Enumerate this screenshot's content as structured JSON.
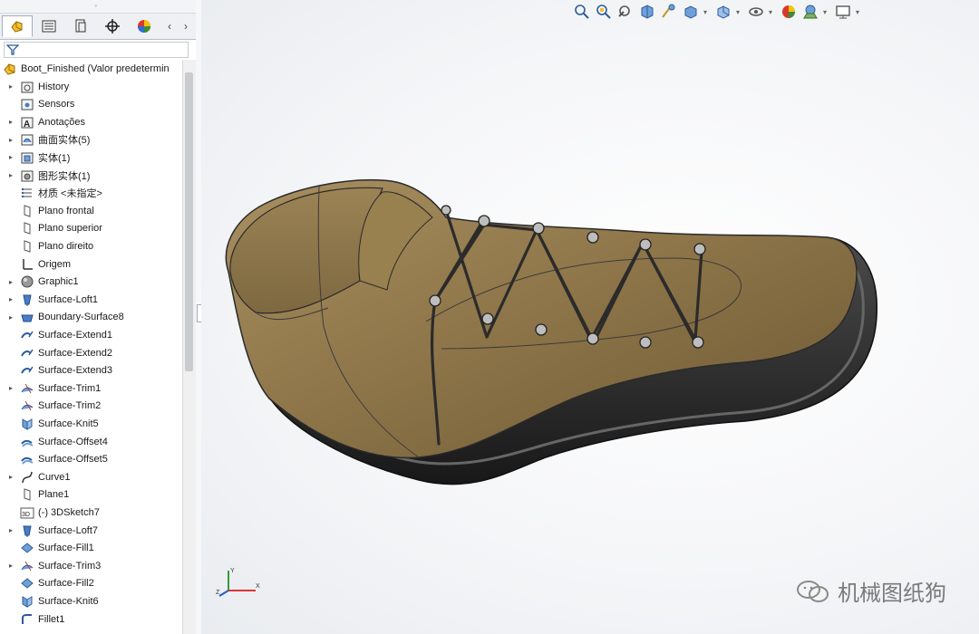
{
  "tree": {
    "root_label": "Boot_Finished  (Valor predetermin",
    "items": [
      {
        "label": "History",
        "icon": "history-folder-icon",
        "expandable": true
      },
      {
        "label": "Sensors",
        "icon": "sensor-icon",
        "expandable": false
      },
      {
        "label": "Anotações",
        "icon": "annotations-icon",
        "expandable": true
      },
      {
        "label": "曲面实体(5)",
        "icon": "surface-bodies-icon",
        "expandable": true
      },
      {
        "label": "实体(1)",
        "icon": "solid-bodies-icon",
        "expandable": true
      },
      {
        "label": "图形实体(1)",
        "icon": "graphic-bodies-icon",
        "expandable": true
      },
      {
        "label": "材质 <未指定>",
        "icon": "material-icon",
        "expandable": false
      },
      {
        "label": "Plano frontal",
        "icon": "plane-icon",
        "expandable": false
      },
      {
        "label": "Plano superior",
        "icon": "plane-icon",
        "expandable": false
      },
      {
        "label": "Plano direito",
        "icon": "plane-icon",
        "expandable": false
      },
      {
        "label": "Origem",
        "icon": "origin-icon",
        "expandable": false
      },
      {
        "label": "Graphic1",
        "icon": "graphic-icon",
        "expandable": true
      },
      {
        "label": "Surface-Loft1",
        "icon": "loft-icon",
        "expandable": true
      },
      {
        "label": "Boundary-Surface8",
        "icon": "boundary-surface-icon",
        "expandable": true
      },
      {
        "label": "Surface-Extend1",
        "icon": "surface-extend-icon",
        "expandable": false
      },
      {
        "label": "Surface-Extend2",
        "icon": "surface-extend-icon",
        "expandable": false
      },
      {
        "label": "Surface-Extend3",
        "icon": "surface-extend-icon",
        "expandable": false
      },
      {
        "label": "Surface-Trim1",
        "icon": "surface-trim-icon",
        "expandable": true
      },
      {
        "label": "Surface-Trim2",
        "icon": "surface-trim-icon",
        "expandable": false
      },
      {
        "label": "Surface-Knit5",
        "icon": "surface-knit-icon",
        "expandable": false
      },
      {
        "label": "Surface-Offset4",
        "icon": "surface-offset-icon",
        "expandable": false
      },
      {
        "label": "Surface-Offset5",
        "icon": "surface-offset-icon",
        "expandable": false
      },
      {
        "label": "Curve1",
        "icon": "curve-icon",
        "expandable": true
      },
      {
        "label": "Plane1",
        "icon": "plane-icon",
        "expandable": false
      },
      {
        "label": "(-) 3DSketch7",
        "icon": "3dsketch-icon",
        "expandable": false
      },
      {
        "label": "Surface-Loft7",
        "icon": "loft-icon",
        "expandable": true
      },
      {
        "label": "Surface-Fill1",
        "icon": "surface-fill-icon",
        "expandable": false
      },
      {
        "label": "Surface-Trim3",
        "icon": "surface-trim-icon",
        "expandable": true
      },
      {
        "label": "Surface-Fill2",
        "icon": "surface-fill-icon",
        "expandable": false
      },
      {
        "label": "Surface-Knit6",
        "icon": "surface-knit-icon",
        "expandable": false
      },
      {
        "label": "Fillet1",
        "icon": "fillet-icon",
        "expandable": false
      }
    ]
  },
  "tabs": [
    {
      "name": "feature-manager-tab",
      "icon": "feature-manager-icon",
      "active": true
    },
    {
      "name": "property-manager-tab",
      "icon": "property-manager-icon",
      "active": false
    },
    {
      "name": "configuration-manager-tab",
      "icon": "configuration-manager-icon",
      "active": false
    },
    {
      "name": "dimxpert-manager-tab",
      "icon": "dimxpert-icon",
      "active": false
    },
    {
      "name": "display-manager-tab",
      "icon": "display-manager-icon",
      "active": false
    }
  ],
  "toolbar": [
    "zoom-to-fit-icon",
    "zoom-to-area-icon",
    "previous-view-icon",
    "section-view-icon",
    "dynamic-annotation-icon",
    "view-orientation-icon",
    "display-style-icon",
    "hide-show-items-icon",
    "edit-appearance-icon",
    "apply-scene-icon",
    "view-settings-icon"
  ],
  "watermark": {
    "text": "机械图纸狗",
    "icon": "wechat-icon"
  },
  "triad_labels": {
    "x": "X",
    "y": "Y",
    "z": "Z"
  },
  "colors": {
    "leather": "#8c7448",
    "sole": "#2a2a2a",
    "lace": "#2b2b2b",
    "accent": "#1d74c9"
  }
}
